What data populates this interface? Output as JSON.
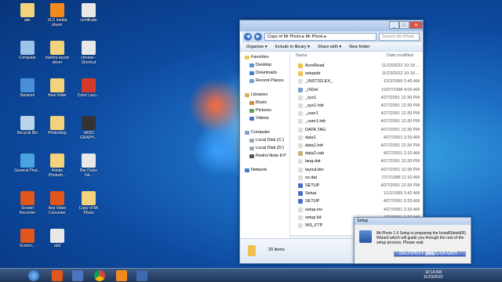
{
  "desktop": {
    "icons": [
      {
        "label": "abc",
        "color": "#f2d27a"
      },
      {
        "label": "VLC media player",
        "color": "#f08a1c"
      },
      {
        "label": "certificate",
        "color": "#e8e8e8"
      },
      {
        "label": "Computer",
        "color": "#9fc3e6"
      },
      {
        "label": "mantra epson driver",
        "color": "#f2d27a"
      },
      {
        "label": "chrome - Shortcut",
        "color": "#e8e8e8"
      },
      {
        "label": "Network",
        "color": "#4a8fd6"
      },
      {
        "label": "New folder",
        "color": "#f2d27a"
      },
      {
        "label": "Color Laco...",
        "color": "#d43a2a"
      },
      {
        "label": "Recycle Bin",
        "color": "#bcd4ea"
      },
      {
        "label": "Photoshop",
        "color": "#f2d27a"
      },
      {
        "label": "VADO GRAPH...",
        "color": "#333333"
      },
      {
        "label": "General Phot...",
        "color": "#4aa3e0"
      },
      {
        "label": "Adobe Photosh...",
        "color": "#f2d27a"
      },
      {
        "label": "Bar Dulce Yal...",
        "color": "#e8e8e8"
      },
      {
        "label": "Screen Recorder",
        "color": "#e0561c"
      },
      {
        "label": "Any Video Converter",
        "color": "#e0561c"
      },
      {
        "label": "Copy of Mr Photo",
        "color": "#f2d27a"
      },
      {
        "label": "Screen...",
        "color": "#e0561c"
      },
      {
        "label": "abd",
        "color": "#e8e8e8"
      }
    ]
  },
  "explorer": {
    "breadcrumb": "Copy of Mr Photo  ▸  Mr Photo  ▸",
    "search_placeholder": "Search Mr Photo",
    "toolbar": {
      "organize": "Organize ▾",
      "include": "Include in library ▾",
      "share": "Share with ▾",
      "new_folder": "New folder"
    },
    "nav": {
      "favorites": "Favorites",
      "desktop": "Desktop",
      "downloads": "Downloads",
      "recent": "Recent Places",
      "libraries": "Libraries",
      "music": "Music",
      "pictures": "Pictures",
      "videos": "Videos",
      "computer": "Computer",
      "c_drive": "Local Disk (C:)",
      "d_drive": "Local Disk (D:)",
      "phone": "Redmi Note 8 P",
      "network": "Network"
    },
    "columns": {
      "name": "Name",
      "date": "Date modified"
    },
    "files": [
      {
        "name": "AcroRead",
        "date": "11/23/2022 10:18 ...",
        "color": "#f2c04e"
      },
      {
        "name": "setupdir",
        "date": "11/23/2022 10:18 ...",
        "color": "#f2c04e"
      },
      {
        "name": "_INST32I.EX_",
        "date": "12/3/1999 2:45 AM",
        "color": "#dddddd"
      },
      {
        "name": "_ISDel",
        "date": "10/27/1998 4:00 AM",
        "color": "#7aa0d0"
      },
      {
        "name": "_sys1",
        "date": "4/27/2001 12:39 PM",
        "color": "#dddddd"
      },
      {
        "name": "_sys1.hdr",
        "date": "4/27/2001 12:39 PM",
        "color": "#dddddd"
      },
      {
        "name": "_user1",
        "date": "4/27/2001 12:39 PM",
        "color": "#dddddd"
      },
      {
        "name": "_user1.hdr",
        "date": "4/27/2001 12:39 PM",
        "color": "#dddddd"
      },
      {
        "name": "DATA.TAG",
        "date": "4/27/2001 12:39 PM",
        "color": "#dddddd"
      },
      {
        "name": "data1",
        "date": "4/27/2001 2:33 AM",
        "color": "#dddddd"
      },
      {
        "name": "data1.hdr",
        "date": "4/27/2001 12:39 PM",
        "color": "#dddddd"
      },
      {
        "name": "data2.cab",
        "date": "4/27/2001 2:33 AM",
        "color": "#c7b07a"
      },
      {
        "name": "lang.dat",
        "date": "4/27/2001 12:39 PM",
        "color": "#dddddd"
      },
      {
        "name": "layout.bin",
        "date": "4/27/2001 12:39 PM",
        "color": "#dddddd"
      },
      {
        "name": "os.dat",
        "date": "7/27/1998 11:32 AM",
        "color": "#dddddd"
      },
      {
        "name": "SETUP",
        "date": "4/27/2001 12:39 PM",
        "color": "#4a6fc4"
      },
      {
        "name": "Setup",
        "date": "1/12/1999 3:42 AM",
        "color": "#4a6fc4"
      },
      {
        "name": "SETUP",
        "date": "4/27/2001 2:33 AM",
        "color": "#4a6fc4"
      },
      {
        "name": "setup.ins",
        "date": "4/27/2001 2:33 AM",
        "color": "#dddddd"
      },
      {
        "name": "setup.lid",
        "date": "4/27/2001 2:33 AM",
        "color": "#dddddd"
      },
      {
        "name": "WS_FTP",
        "date": "4/27/2001 2:33 AM",
        "color": "#dddddd"
      }
    ],
    "status": "20 items"
  },
  "setup": {
    "title": "Setup",
    "message": "Mr.Photo 1.6 Setup is preparing the InstallShield(R) Wizard which will guide you through the rest of the setup process.  Please wait.",
    "progress_label": "100%",
    "progress": 1.0
  },
  "taskbar": {
    "time": "10:14 AM",
    "date": "11/23/2022"
  },
  "watermark": "Screen Recorder"
}
